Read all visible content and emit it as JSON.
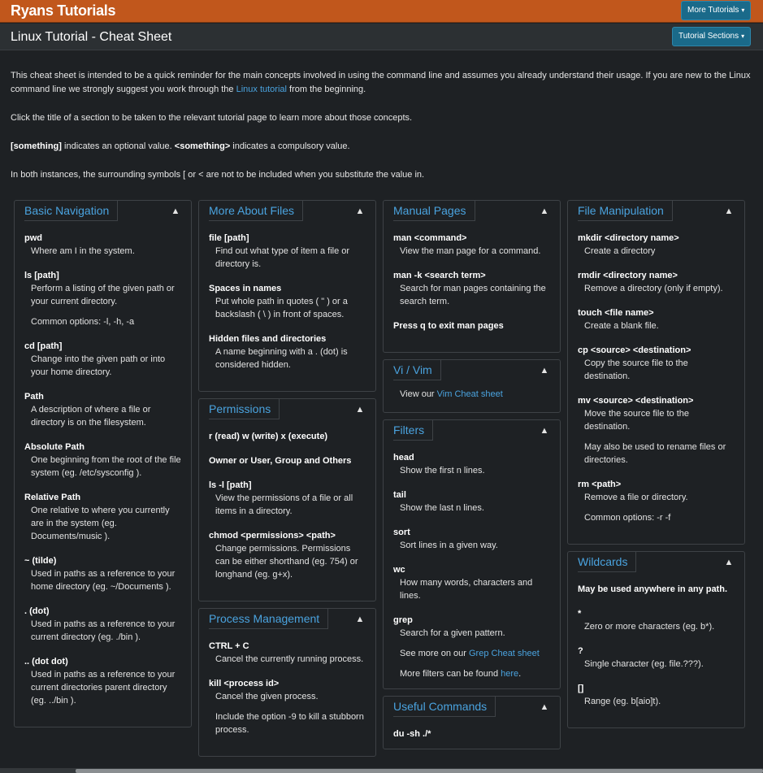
{
  "header": {
    "brand": "Ryans Tutorials",
    "more_tutorials_label": "More Tutorials",
    "page_title": "Linux Tutorial - Cheat Sheet",
    "sections_label": "Tutorial Sections"
  },
  "intro": {
    "p1_pre": "This cheat sheet is intended to be a quick reminder for the main concepts involved in using the command line and assumes you already understand their usage. If you are new to the Linux command line we strongly suggest you work through the ",
    "p1_link": "Linux tutorial",
    "p1_post": " from the beginning.",
    "p2": "Click the title of a section to be taken to the relevant tutorial page to learn more about those concepts.",
    "p3_opt": "[something]",
    "p3_mid": " indicates an optional value. ",
    "p3_req": "<something>",
    "p3_end": " indicates a compulsory value.",
    "p4": "In both instances, the surrounding symbols [ or < are not to be included when you substitute the value in."
  },
  "panels": {
    "basic_nav": {
      "title": "Basic Navigation",
      "items": [
        {
          "term": "pwd",
          "desc": "Where am I in the system."
        },
        {
          "term": "ls [path]",
          "desc": "Perform a listing of the given path or your current directory.",
          "extra": "Common options: -l, -h, -a"
        },
        {
          "term": "cd [path]",
          "desc": "Change into the given path or into your home directory."
        },
        {
          "term": "Path",
          "desc": "A description of where a file or directory is on the filesystem."
        },
        {
          "term": "Absolute Path",
          "desc": "One beginning from the root of the file system (eg. /etc/sysconfig )."
        },
        {
          "term": "Relative Path",
          "desc": "One relative to where you currently are in the system (eg. Documents/music )."
        },
        {
          "term": "~ (tilde)",
          "desc": "Used in paths as a reference to your home directory (eg. ~/Documents )."
        },
        {
          "term": ". (dot)",
          "desc": "Used in paths as a reference to your current directory (eg. ./bin )."
        },
        {
          "term": ".. (dot dot)",
          "desc": "Used in paths as a reference to your current directories parent directory (eg. ../bin )."
        }
      ]
    },
    "more_files": {
      "title": "More About Files",
      "items": [
        {
          "term": "file [path]",
          "desc": "Find out what type of item a file or directory is."
        },
        {
          "term": "Spaces in names",
          "desc": "Put whole path in quotes ( \" ) or a backslash ( \\ ) in front of spaces."
        },
        {
          "term": "Hidden files and directories",
          "desc": "A name beginning with a . (dot) is considered hidden."
        }
      ]
    },
    "permissions": {
      "title": "Permissions",
      "items": [
        {
          "term": "r (read) w (write) x (execute)"
        },
        {
          "term": "Owner or User, Group and Others"
        },
        {
          "term": "ls -l [path]",
          "desc": "View the permissions of a file or all items in a directory."
        },
        {
          "term": "chmod <permissions> <path>",
          "desc": "Change permissions. Permissions can be either shorthand (eg. 754) or longhand (eg. g+x)."
        }
      ]
    },
    "process": {
      "title": "Process Management",
      "items": [
        {
          "term": "CTRL + C",
          "desc": "Cancel the currently running process."
        },
        {
          "term": "kill <process id>",
          "desc": "Cancel the given process.",
          "extra": "Include the option -9 to kill a stubborn process."
        }
      ]
    },
    "manual": {
      "title": "Manual Pages",
      "items": [
        {
          "term": "man <command>",
          "desc": "View the man page for a command."
        },
        {
          "term": "man -k <search term>",
          "desc": "Search for man pages containing the search term."
        },
        {
          "term": "Press q to exit man pages"
        }
      ]
    },
    "vim": {
      "title": "Vi / Vim",
      "text_pre": "View our ",
      "link": "Vim Cheat sheet"
    },
    "filters": {
      "title": "Filters",
      "items": [
        {
          "term": "head",
          "desc": "Show the first n lines."
        },
        {
          "term": "tail",
          "desc": "Show the last n lines."
        },
        {
          "term": "sort",
          "desc": "Sort lines in a given way."
        },
        {
          "term": "wc",
          "desc": "How many words, characters and lines."
        },
        {
          "term": "grep",
          "desc": "Search for a given pattern."
        }
      ],
      "grep_more_pre": "See more on our ",
      "grep_more_link": "Grep Cheat sheet",
      "more_pre": "More filters can be found ",
      "more_link": "here",
      "more_post": "."
    },
    "useful": {
      "title": "Useful Commands",
      "first_term": "du -sh ./*"
    },
    "file_manip": {
      "title": "File Manipulation",
      "items": [
        {
          "term": "mkdir <directory name>",
          "desc": "Create a directory"
        },
        {
          "term": "rmdir <directory name>",
          "desc": "Remove a directory (only if empty)."
        },
        {
          "term": "touch <file name>",
          "desc": "Create a blank file."
        },
        {
          "term": "cp <source> <destination>",
          "desc": "Copy the source file to the destination."
        },
        {
          "term": "mv <source> <destination>",
          "desc": "Move the source file to the destination.",
          "extra": "May also be used to rename files or directories."
        },
        {
          "term": "rm <path>",
          "desc": "Remove a file or directory.",
          "extra": "Common options: -r -f"
        }
      ]
    },
    "wildcards": {
      "title": "Wildcards",
      "items": [
        {
          "term": "May be used anywhere in any path."
        },
        {
          "term": "*",
          "desc": "Zero or more characters (eg. b*)."
        },
        {
          "term": "?",
          "desc": "Single character (eg. file.???)."
        },
        {
          "term": "[]",
          "desc": "Range (eg. b[aio]t)."
        }
      ]
    }
  },
  "icons": {
    "collapse": "chevron-up-icon",
    "dropdown": "caret-down-icon"
  },
  "colors": {
    "brand_bar": "#c1571c",
    "link": "#4aa3df",
    "button": "#1a6a8a",
    "background": "#1e2124"
  }
}
